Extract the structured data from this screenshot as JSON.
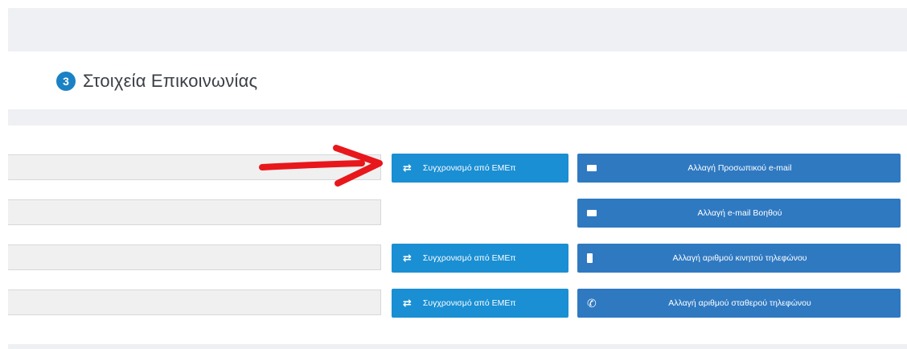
{
  "section": {
    "step_number": "3",
    "title": "Στοιχεία Επικοινωνίας"
  },
  "rows": [
    {
      "field_value": "",
      "sync_label": "Συγχρονισμό από ΕΜΕπ",
      "action_label": "Αλλαγή Προσωπικού e-mail",
      "action_icon": "envelope-icon"
    },
    {
      "field_value": "",
      "action_label": "Αλλαγή e-mail Βοηθού",
      "action_icon": "envelope-icon"
    },
    {
      "field_value": "",
      "sync_label": "Συγχρονισμό από ΕΜΕπ",
      "action_label": "Αλλαγή αριθμού κινητού τηλεφώνου",
      "action_icon": "mobile-phone-icon"
    },
    {
      "field_value": "",
      "sync_label": "Συγχρονισμό από ΕΜΕπ",
      "action_label": "Αλλαγή αριθμού σταθερού τηλεφώνου",
      "action_icon": "phone-icon"
    }
  ],
  "icons": {
    "sync": "exchange-arrows-icon",
    "annotation": "red-arrow-icon"
  },
  "colors": {
    "sync_button": "#1a8fd3",
    "action_button": "#2f79c1",
    "step_badge": "#1a82c4",
    "annotation_arrow": "#e8171b",
    "band": "#eef0f4",
    "field": "#f0f0f0"
  }
}
